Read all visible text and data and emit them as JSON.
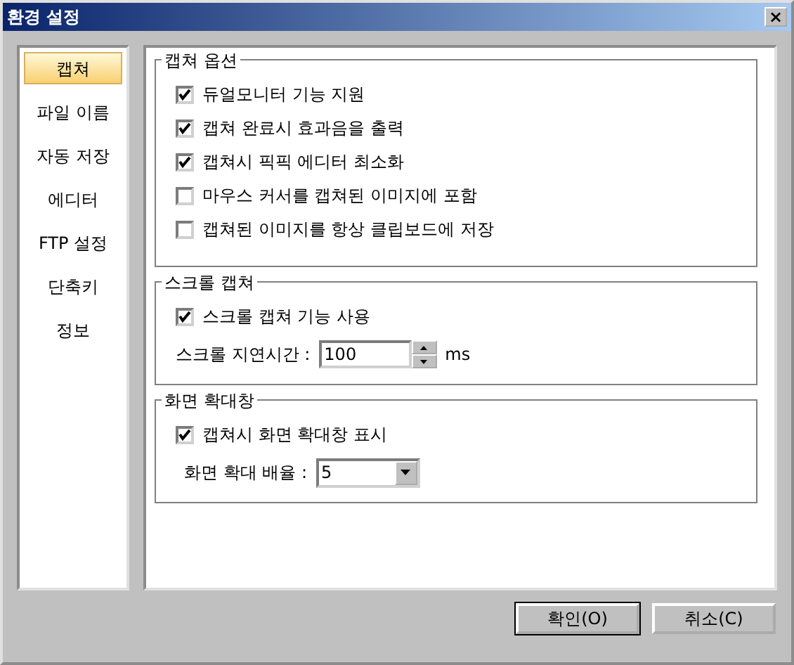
{
  "window": {
    "title": "환경 설정",
    "close": "×"
  },
  "sidebar": {
    "items": [
      {
        "label": "캡쳐",
        "selected": true
      },
      {
        "label": "파일 이름",
        "selected": false
      },
      {
        "label": "자동 저장",
        "selected": false
      },
      {
        "label": "에디터",
        "selected": false
      },
      {
        "label": "FTP 설정",
        "selected": false
      },
      {
        "label": "단축키",
        "selected": false
      },
      {
        "label": "정보",
        "selected": false
      }
    ]
  },
  "groups": [
    {
      "title": "캡쳐 옵션",
      "rows": [
        {
          "kind": "checkbox",
          "label": "듀얼모니터 기능 지원",
          "checked": true
        },
        {
          "kind": "checkbox",
          "label": "캡쳐 완료시 효과음을 출력",
          "checked": true
        },
        {
          "kind": "checkbox",
          "label": "캡쳐시 픽픽 에디터 최소화",
          "checked": true
        },
        {
          "kind": "checkbox",
          "label": "마우스 커서를 캡쳐된 이미지에 포함",
          "checked": false
        },
        {
          "kind": "checkbox",
          "label": "캡쳐된 이미지를 항상 클립보드에 저장",
          "checked": false
        }
      ]
    },
    {
      "title": "스크롤 캡쳐",
      "rows": [
        {
          "kind": "checkbox",
          "label": "스크롤 캡쳐 기능 사용",
          "checked": true
        },
        {
          "kind": "spin",
          "label": "스크롤 지연시간 :",
          "value": "100",
          "unit": "ms"
        }
      ]
    },
    {
      "title": "화면 확대창",
      "rows": [
        {
          "kind": "checkbox",
          "label": "캡쳐시 화면 확대창 표시",
          "checked": true
        },
        {
          "kind": "combo",
          "label": "화면 확대 배율 :",
          "value": "5"
        }
      ]
    }
  ],
  "buttons": [
    "확인(O)",
    "취소(C)"
  ]
}
